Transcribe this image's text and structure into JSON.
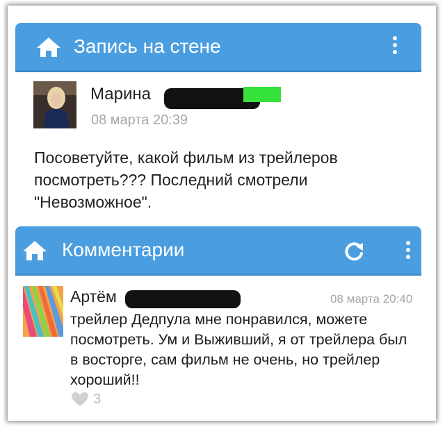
{
  "post_header": {
    "title": "Запись на стене",
    "icon": "home-icon",
    "menu_icon": "kebab-icon"
  },
  "post": {
    "author": "Марина",
    "date": "08 марта 20:39",
    "text": "Посоветуйте, какой фильм из трейлеров посмотреть??? Последний смотрели \"Невозможное\"."
  },
  "comments_header": {
    "title": "Комментарии",
    "icon": "home-icon",
    "refresh_icon": "refresh-icon",
    "menu_icon": "kebab-icon"
  },
  "comment": {
    "author": "Артём",
    "date": "08 марта 20:40",
    "text": "трейлер Дедпула мне понравился, можете посмотреть. Ум и Выживший, я от трейлера был в восторге, сам фильм не очень, но трейлер хороший!!",
    "likes": "3"
  },
  "colors": {
    "header_bar": "#4a9ee0",
    "date_text": "#a7a7a7",
    "like": "#d0d0d0"
  }
}
